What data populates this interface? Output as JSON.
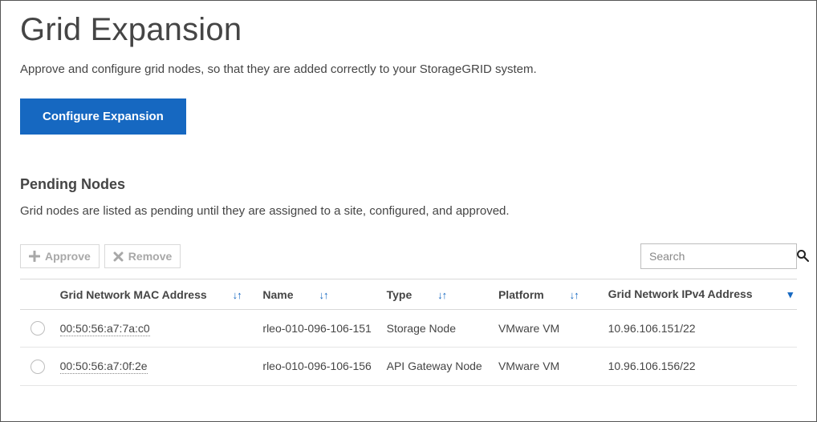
{
  "page": {
    "title": "Grid Expansion",
    "description": "Approve and configure grid nodes, so that they are added correctly to your StorageGRID system."
  },
  "buttons": {
    "configure_expansion": "Configure Expansion",
    "approve": "Approve",
    "remove": "Remove"
  },
  "pending": {
    "title": "Pending Nodes",
    "description": "Grid nodes are listed as pending until they are assigned to a site, configured, and approved."
  },
  "search": {
    "placeholder": "Search"
  },
  "columns": {
    "mac": "Grid Network MAC Address",
    "name": "Name",
    "type": "Type",
    "platform": "Platform",
    "ip": "Grid Network IPv4 Address"
  },
  "rows": [
    {
      "mac": "00:50:56:a7:7a:c0",
      "name": "rleo-010-096-106-151",
      "type": "Storage Node",
      "platform": "VMware VM",
      "ip": "10.96.106.151/22"
    },
    {
      "mac": "00:50:56:a7:0f:2e",
      "name": "rleo-010-096-106-156",
      "type": "API Gateway Node",
      "platform": "VMware VM",
      "ip": "10.96.106.156/22"
    }
  ]
}
